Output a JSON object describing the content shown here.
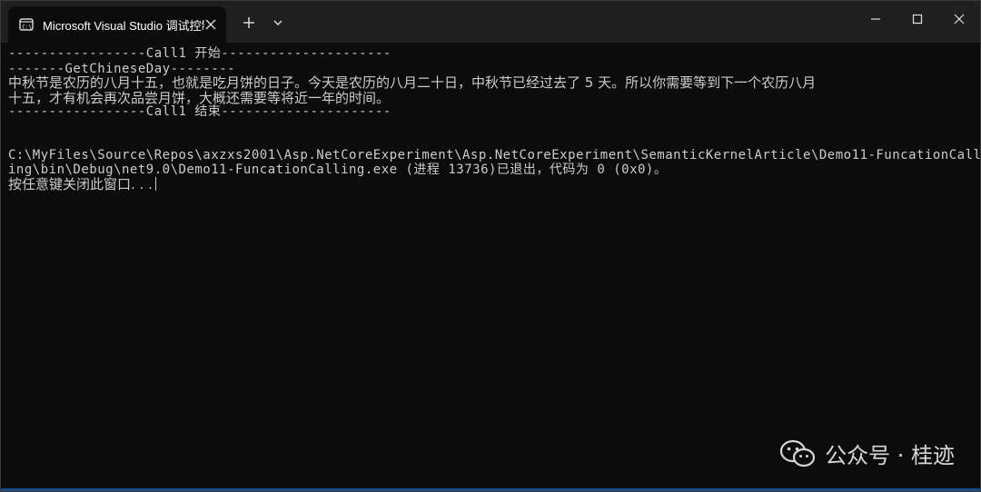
{
  "window": {
    "tab_title": "Microsoft Visual Studio 调试控制台",
    "new_tab_label": "+",
    "colors": {
      "titlebar": "#1f1f1f",
      "console_bg": "#0c0c0c",
      "console_text": "#cccccc"
    }
  },
  "console": {
    "lines": [
      "-----------------Call1 开始---------------------",
      "-------GetChineseDay--------",
      "中秋节是农历的八月十五，也就是吃月饼的日子。今天是农历的八月二十日，中秋节已经过去了 5 天。所以你需要等到下一个农历八月",
      "十五，才有机会再次品尝月饼，大概还需要等将近一年的时间。",
      "-----------------Call1 结束---------------------",
      "",
      "",
      "C:\\MyFiles\\Source\\Repos\\axzxs2001\\Asp.NetCoreExperiment\\Asp.NetCoreExperiment\\SemanticKernelArticle\\Demo11-FuncationCall",
      "ing\\bin\\Debug\\net9.0\\Demo11-FuncationCalling.exe (进程 13736)已退出，代码为 0 (0x0)。",
      "按任意键关闭此窗口. . ."
    ]
  },
  "watermark": {
    "text": "公众号 · 桂迹",
    "icon": "wechat-icon"
  }
}
